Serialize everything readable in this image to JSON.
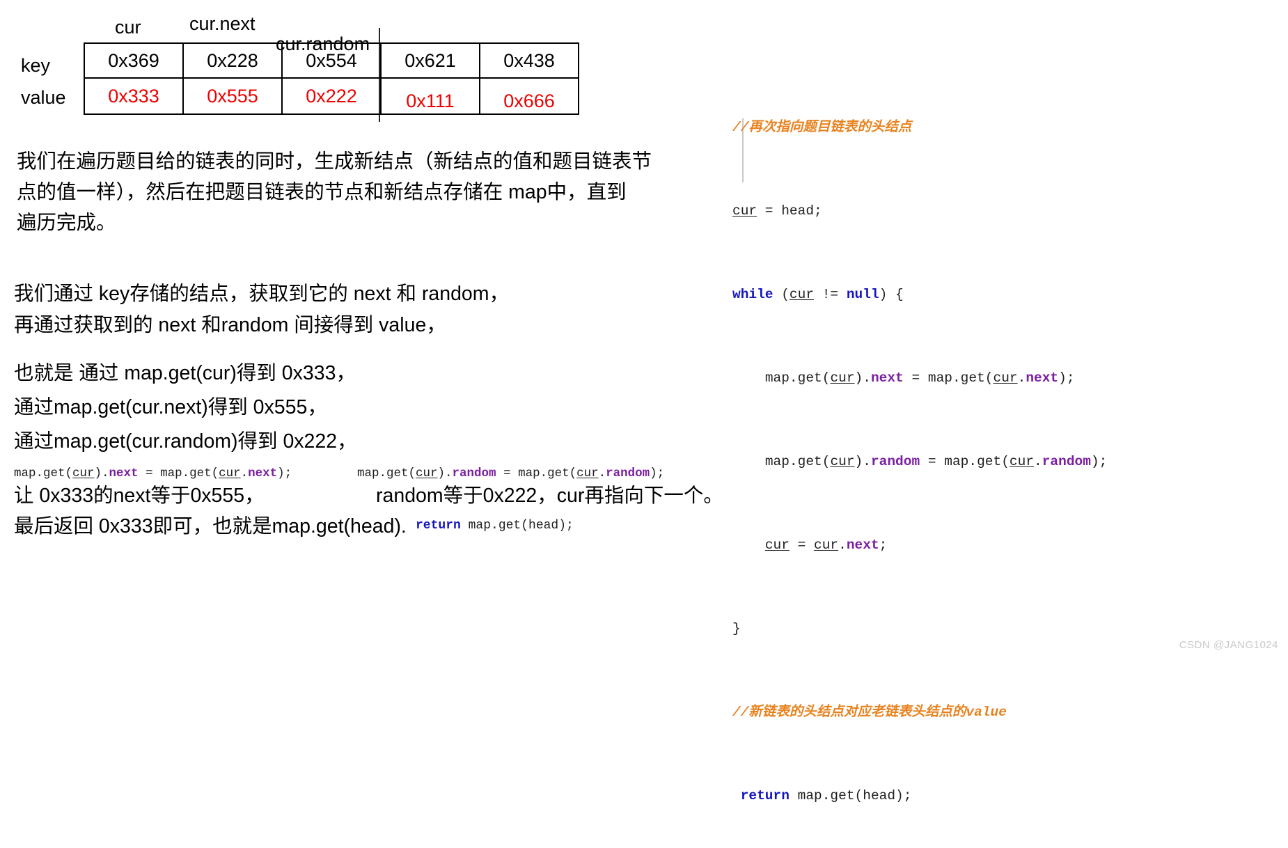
{
  "map_diagram": {
    "pointer_labels": {
      "cur": "cur",
      "cur_next": "cur.next",
      "cur_random": "cur.random"
    },
    "row_headers": {
      "key": "key",
      "value": "value"
    },
    "keys": [
      "0x369",
      "0x228",
      "0x554",
      "0x621",
      "0x438"
    ],
    "values": [
      "0x333",
      "0x555",
      "0x222",
      "0x111",
      "0x666"
    ],
    "value_color": "#ee0000",
    "key_color": "#000000"
  },
  "paragraph_1": {
    "line_1": "我们在遍历题目给的链表的同时，生成新结点（新结点的值和题目链表节",
    "line_2": "点的值一样），然后在把题目链表的节点和新结点存储在 map中，直到",
    "line_3": "遍历完成。"
  },
  "paragraph_2": {
    "line_1": "我们通过 key存储的结点，获取到它的 next 和 random，",
    "line_2": "再通过获取到的 next 和random 间接得到  value，"
  },
  "paragraph_3": {
    "line_1": "也就是 通过 map.get(cur)得到 0x333，",
    "line_2": "通过map.get(cur.next)得到 0x555，",
    "line_3": "通过map.get(cur.random)得到 0x222，"
  },
  "bottom": {
    "code_next": {
      "p1": "map.get(",
      "var1": "cur",
      "p2": ").",
      "prop1": "next",
      "p3": " = map.get(",
      "var2": "cur",
      "p4": ".",
      "prop2": "next",
      "p5": ");"
    },
    "code_random": {
      "p1": "map.get(",
      "var1": "cur",
      "p2": ").",
      "prop1": "random",
      "p3": " = map.get(",
      "var2": "cur",
      "p4": ".",
      "prop2": "random",
      "p5": ");"
    },
    "line_1": "让 0x333的next等于0x555，",
    "line_2": "random等于0x222，cur再指向下一个。",
    "line_3": "最后返回 0x333即可，也就是map.get(head).",
    "code_return": {
      "keyword": "return",
      "rest": " map.get(head);"
    }
  },
  "code_panel": {
    "comment_1": "//再次指向题目链表的头结点",
    "line_cur_assign": {
      "var": "cur",
      "rest": " = head;"
    },
    "line_while": {
      "keyword": "while",
      "open": " (",
      "var": "cur",
      "op": " != ",
      "null_kw": "null",
      "close": ") {"
    },
    "line_next": {
      "indent": "    ",
      "p1": "map.get(",
      "var1": "cur",
      "p2": ").",
      "prop1": "next",
      "p3": " = map.get(",
      "var2": "cur",
      "p4": ".",
      "prop2": "next",
      "p5": ");"
    },
    "line_random": {
      "indent": "    ",
      "p1": "map.get(",
      "var1": "cur",
      "p2": ").",
      "prop1": "random",
      "p3": " = map.get(",
      "var2": "cur",
      "p4": ".",
      "prop2": "random",
      "p5": ");"
    },
    "line_advance": {
      "indent": "    ",
      "var1": "cur",
      "p1": " = ",
      "var2": "cur",
      "p2": ".",
      "prop": "next",
      "p3": ";"
    },
    "line_close_brace": "}",
    "comment_2": "//新链表的头结点对应老链表头结点的value",
    "line_return": {
      "keyword": " return",
      "rest": " map.get(head);"
    },
    "colors": {
      "comment": "#e8821e",
      "keyword": "#1515c0",
      "property": "#7b1fa2",
      "plain": "#202020"
    }
  },
  "watermark": "CSDN @JANG1024"
}
